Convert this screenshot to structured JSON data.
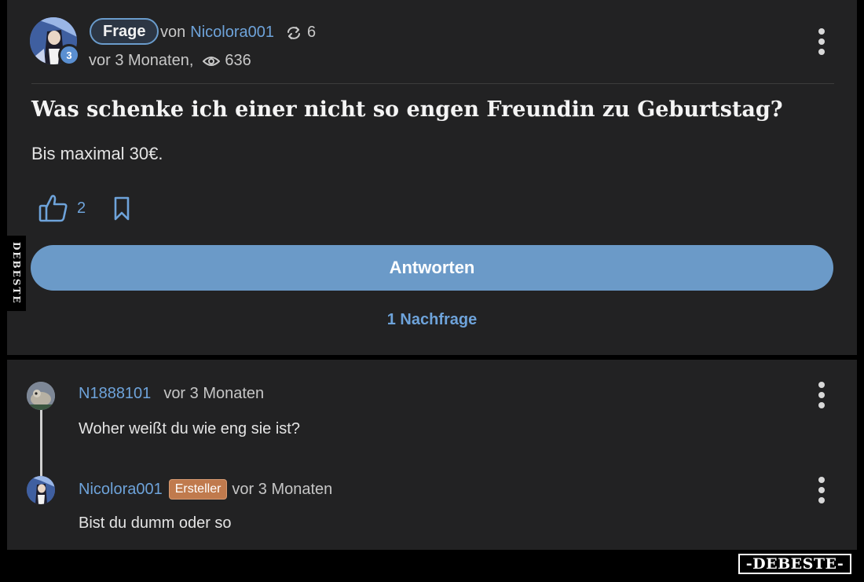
{
  "question": {
    "type_label": "Frage",
    "by_label": "von",
    "author": "Nicolora001",
    "repost_count": "6",
    "time": "vor 3 Monaten,",
    "views": "636",
    "level": "3",
    "title": "Was schenke ich einer nicht so engen Freundin zu Geburtstag?",
    "body": "Bis maximal 30€.",
    "likes": "2",
    "answer_button": "Antworten",
    "followups": "1 Nachfrage"
  },
  "comments": [
    {
      "author": "N1888101",
      "time": "vor 3 Monaten",
      "text": "Woher weißt du wie eng sie ist?"
    },
    {
      "author": "Nicolora001",
      "badge": "Ersteller",
      "time": "vor 3 Monaten",
      "text": "Bist du dumm oder so"
    }
  ],
  "watermark": {
    "side": "DEBESTE",
    "bottom": "-DEBESTE-"
  },
  "colors": {
    "accent": "#6ea3da",
    "button": "#6b9ac8",
    "badge": "#c07a4d",
    "card": "#222223"
  },
  "icons": [
    "repost-icon",
    "eye-icon",
    "thumbs-up-icon",
    "bookmark-icon",
    "more-vertical-icon"
  ]
}
